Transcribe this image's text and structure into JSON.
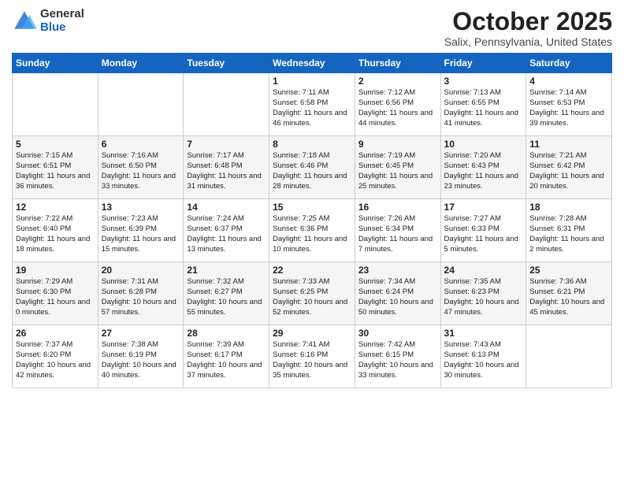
{
  "header": {
    "logo": {
      "general": "General",
      "blue": "Blue"
    },
    "title": "October 2025",
    "location": "Salix, Pennsylvania, United States"
  },
  "weekdays": [
    "Sunday",
    "Monday",
    "Tuesday",
    "Wednesday",
    "Thursday",
    "Friday",
    "Saturday"
  ],
  "weeks": [
    [
      {
        "day": "",
        "info": ""
      },
      {
        "day": "",
        "info": ""
      },
      {
        "day": "",
        "info": ""
      },
      {
        "day": "1",
        "info": "Sunrise: 7:11 AM\nSunset: 6:58 PM\nDaylight: 11 hours\nand 46 minutes."
      },
      {
        "day": "2",
        "info": "Sunrise: 7:12 AM\nSunset: 6:56 PM\nDaylight: 11 hours\nand 44 minutes."
      },
      {
        "day": "3",
        "info": "Sunrise: 7:13 AM\nSunset: 6:55 PM\nDaylight: 11 hours\nand 41 minutes."
      },
      {
        "day": "4",
        "info": "Sunrise: 7:14 AM\nSunset: 6:53 PM\nDaylight: 11 hours\nand 39 minutes."
      }
    ],
    [
      {
        "day": "5",
        "info": "Sunrise: 7:15 AM\nSunset: 6:51 PM\nDaylight: 11 hours\nand 36 minutes."
      },
      {
        "day": "6",
        "info": "Sunrise: 7:16 AM\nSunset: 6:50 PM\nDaylight: 11 hours\nand 33 minutes."
      },
      {
        "day": "7",
        "info": "Sunrise: 7:17 AM\nSunset: 6:48 PM\nDaylight: 11 hours\nand 31 minutes."
      },
      {
        "day": "8",
        "info": "Sunrise: 7:18 AM\nSunset: 6:46 PM\nDaylight: 11 hours\nand 28 minutes."
      },
      {
        "day": "9",
        "info": "Sunrise: 7:19 AM\nSunset: 6:45 PM\nDaylight: 11 hours\nand 25 minutes."
      },
      {
        "day": "10",
        "info": "Sunrise: 7:20 AM\nSunset: 6:43 PM\nDaylight: 11 hours\nand 23 minutes."
      },
      {
        "day": "11",
        "info": "Sunrise: 7:21 AM\nSunset: 6:42 PM\nDaylight: 11 hours\nand 20 minutes."
      }
    ],
    [
      {
        "day": "12",
        "info": "Sunrise: 7:22 AM\nSunset: 6:40 PM\nDaylight: 11 hours\nand 18 minutes."
      },
      {
        "day": "13",
        "info": "Sunrise: 7:23 AM\nSunset: 6:39 PM\nDaylight: 11 hours\nand 15 minutes."
      },
      {
        "day": "14",
        "info": "Sunrise: 7:24 AM\nSunset: 6:37 PM\nDaylight: 11 hours\nand 13 minutes."
      },
      {
        "day": "15",
        "info": "Sunrise: 7:25 AM\nSunset: 6:36 PM\nDaylight: 11 hours\nand 10 minutes."
      },
      {
        "day": "16",
        "info": "Sunrise: 7:26 AM\nSunset: 6:34 PM\nDaylight: 11 hours\nand 7 minutes."
      },
      {
        "day": "17",
        "info": "Sunrise: 7:27 AM\nSunset: 6:33 PM\nDaylight: 11 hours\nand 5 minutes."
      },
      {
        "day": "18",
        "info": "Sunrise: 7:28 AM\nSunset: 6:31 PM\nDaylight: 11 hours\nand 2 minutes."
      }
    ],
    [
      {
        "day": "19",
        "info": "Sunrise: 7:29 AM\nSunset: 6:30 PM\nDaylight: 11 hours\nand 0 minutes."
      },
      {
        "day": "20",
        "info": "Sunrise: 7:31 AM\nSunset: 6:28 PM\nDaylight: 10 hours\nand 57 minutes."
      },
      {
        "day": "21",
        "info": "Sunrise: 7:32 AM\nSunset: 6:27 PM\nDaylight: 10 hours\nand 55 minutes."
      },
      {
        "day": "22",
        "info": "Sunrise: 7:33 AM\nSunset: 6:25 PM\nDaylight: 10 hours\nand 52 minutes."
      },
      {
        "day": "23",
        "info": "Sunrise: 7:34 AM\nSunset: 6:24 PM\nDaylight: 10 hours\nand 50 minutes."
      },
      {
        "day": "24",
        "info": "Sunrise: 7:35 AM\nSunset: 6:23 PM\nDaylight: 10 hours\nand 47 minutes."
      },
      {
        "day": "25",
        "info": "Sunrise: 7:36 AM\nSunset: 6:21 PM\nDaylight: 10 hours\nand 45 minutes."
      }
    ],
    [
      {
        "day": "26",
        "info": "Sunrise: 7:37 AM\nSunset: 6:20 PM\nDaylight: 10 hours\nand 42 minutes."
      },
      {
        "day": "27",
        "info": "Sunrise: 7:38 AM\nSunset: 6:19 PM\nDaylight: 10 hours\nand 40 minutes."
      },
      {
        "day": "28",
        "info": "Sunrise: 7:39 AM\nSunset: 6:17 PM\nDaylight: 10 hours\nand 37 minutes."
      },
      {
        "day": "29",
        "info": "Sunrise: 7:41 AM\nSunset: 6:16 PM\nDaylight: 10 hours\nand 35 minutes."
      },
      {
        "day": "30",
        "info": "Sunrise: 7:42 AM\nSunset: 6:15 PM\nDaylight: 10 hours\nand 33 minutes."
      },
      {
        "day": "31",
        "info": "Sunrise: 7:43 AM\nSunset: 6:13 PM\nDaylight: 10 hours\nand 30 minutes."
      },
      {
        "day": "",
        "info": ""
      }
    ]
  ]
}
